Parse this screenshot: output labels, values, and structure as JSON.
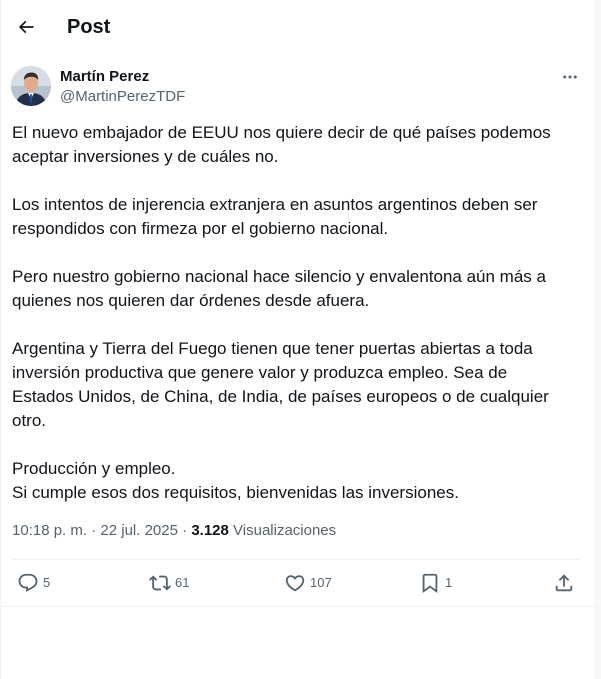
{
  "header": {
    "title": "Post",
    "back_icon": "arrow-left-icon"
  },
  "author": {
    "display_name": "Martín Perez",
    "handle": "@MartinPerezTDF",
    "more_icon": "more-horizontal-icon"
  },
  "tweet": {
    "paragraphs": [
      [
        "El nuevo embajador de EEUU nos quiere decir de qué países podemos",
        "aceptar inversiones y de cuáles no."
      ],
      [
        "Los intentos de injerencia extranjera en asuntos argentinos deben ser",
        "respondidos con firmeza por el gobierno nacional."
      ],
      [
        "Pero nuestro gobierno nacional hace silencio y envalentona aún más a",
        "quienes nos quieren dar órdenes desde afuera."
      ],
      [
        "Argentina y Tierra del Fuego tienen que tener puertas abiertas a toda",
        "inversión productiva que genere valor y produzca empleo. Sea de",
        "Estados Unidos, de China, de India, de países europeos o de cualquier",
        "otro."
      ],
      [
        "Producción y empleo.",
        "Si cumple esos dos requisitos, bienvenidas las inversiones."
      ]
    ]
  },
  "meta": {
    "time": "10:18 p. m.",
    "separator": "·",
    "date": "22 jul. 2025",
    "views_count": "3.128",
    "views_label": "Visualizaciones"
  },
  "actions": {
    "replies": "5",
    "reposts": "61",
    "likes": "107",
    "bookmarks": "1"
  },
  "colors": {
    "text": "#0f1419",
    "secondary": "#536471",
    "divider": "#eff3f4"
  }
}
